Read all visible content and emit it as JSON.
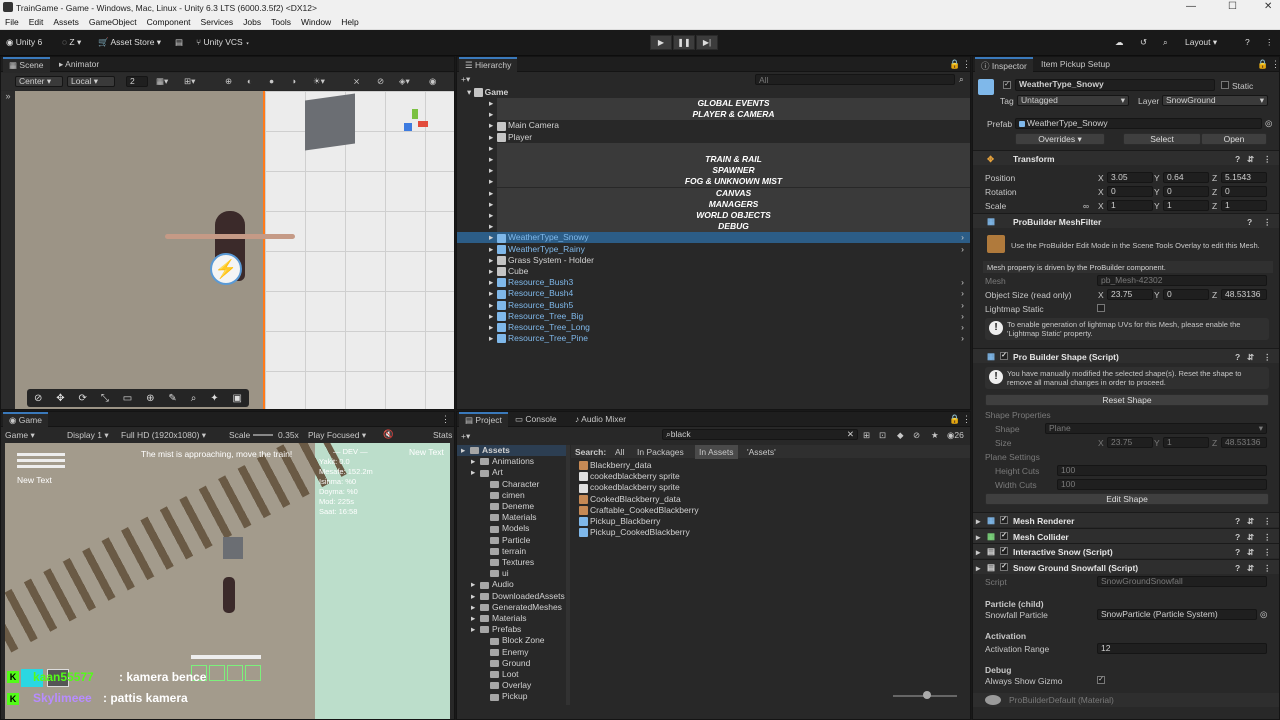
{
  "window": {
    "title": "TrainGame - Game - Windows, Mac, Linux - Unity 6.3 LTS (6000.3.5f2) <DX12>"
  },
  "menu": [
    "File",
    "Edit",
    "Assets",
    "GameObject",
    "Component",
    "Services",
    "Jobs",
    "Tools",
    "Window",
    "Help"
  ],
  "toolbar": {
    "account": "Unity 6",
    "user": "Z",
    "asset_store": "Asset Store",
    "vcs": "Unity VCS",
    "layout": "Layout"
  },
  "scene_panel": {
    "tabs": [
      "Scene",
      "Animator"
    ],
    "pivot": "Center",
    "space": "Local",
    "grid": "2"
  },
  "hierarchy": {
    "tab": "Hierarchy",
    "search_placeholder": "All",
    "root": "Game",
    "items": [
      {
        "label": "GLOBAL EVENTS",
        "kind": "sep"
      },
      {
        "label": "PLAYER & CAMERA",
        "kind": "sep"
      },
      {
        "label": "Main Camera",
        "kind": "obj"
      },
      {
        "label": "Player",
        "kind": "obj"
      },
      {
        "label": "",
        "kind": "sep"
      },
      {
        "label": "TRAIN & RAIL",
        "kind": "sep"
      },
      {
        "label": "SPAWNER",
        "kind": "sep"
      },
      {
        "label": "FOG & UNKNOWN MIST",
        "kind": "sep"
      },
      {
        "label": "CANVAS",
        "kind": "sep"
      },
      {
        "label": "MANAGERS",
        "kind": "sep"
      },
      {
        "label": "WORLD OBJECTS",
        "kind": "sep"
      },
      {
        "label": "DEBUG",
        "kind": "sep"
      },
      {
        "label": "WeatherType_Snowy",
        "kind": "prefab",
        "selected": true
      },
      {
        "label": "WeatherType_Rainy",
        "kind": "prefab"
      },
      {
        "label": "Grass System - Holder",
        "kind": "obj"
      },
      {
        "label": "Cube",
        "kind": "obj"
      },
      {
        "label": "Resource_Bush3",
        "kind": "prefab"
      },
      {
        "label": "Resource_Bush4",
        "kind": "prefab"
      },
      {
        "label": "Resource_Bush5",
        "kind": "prefab"
      },
      {
        "label": "Resource_Tree_Big",
        "kind": "prefab"
      },
      {
        "label": "Resource_Tree_Long",
        "kind": "prefab"
      },
      {
        "label": "Resource_Tree_Pine",
        "kind": "prefab"
      }
    ]
  },
  "game_panel": {
    "tab": "Game",
    "mode": "Game",
    "display": "Display 1",
    "resolution": "Full HD (1920x1080)",
    "scale_label": "Scale",
    "scale": "0.35x",
    "play_mode": "Play Focused",
    "stats": "Stats",
    "hud_text": "New Text",
    "hud_text2": "New Text",
    "banner": "The mist is approaching, move the train!",
    "debug_lines": [
      "— DEV —",
      "Yakit: 0.0",
      "Mesafe: 152.2m",
      "Isinma: %0",
      "Doyma: %0",
      "Mod: 225s",
      "Saat: 16:58"
    ],
    "chat": [
      {
        "user": "kaan55577",
        "msg": ": kamera bence"
      },
      {
        "user": "Skylimeee",
        "msg": ": pattis kamera"
      }
    ]
  },
  "project_panel": {
    "tabs": [
      "Project",
      "Console",
      "Audio Mixer"
    ],
    "search": "black",
    "search_label": "Search:",
    "filters": [
      "All",
      "In Packages",
      "In Assets",
      "'Assets'"
    ],
    "count": "26",
    "tree": [
      {
        "label": "Assets",
        "d": 0
      },
      {
        "label": "Animations",
        "d": 1
      },
      {
        "label": "Art",
        "d": 1
      },
      {
        "label": "Character",
        "d": 2
      },
      {
        "label": "cimen",
        "d": 2
      },
      {
        "label": "Deneme",
        "d": 2
      },
      {
        "label": "Materials",
        "d": 2
      },
      {
        "label": "Models",
        "d": 2
      },
      {
        "label": "Particle",
        "d": 2
      },
      {
        "label": "terrain",
        "d": 2
      },
      {
        "label": "Textures",
        "d": 2
      },
      {
        "label": "ui",
        "d": 2
      },
      {
        "label": "Audio",
        "d": 1
      },
      {
        "label": "DownloadedAssets",
        "d": 1
      },
      {
        "label": "GeneratedMeshes",
        "d": 1
      },
      {
        "label": "Materials",
        "d": 1
      },
      {
        "label": "Prefabs",
        "d": 1
      },
      {
        "label": "Block Zone",
        "d": 2
      },
      {
        "label": "Enemy",
        "d": 2
      },
      {
        "label": "Ground",
        "d": 2
      },
      {
        "label": "Loot",
        "d": 2
      },
      {
        "label": "Overlay",
        "d": 2
      },
      {
        "label": "Pickup",
        "d": 2
      }
    ],
    "results": [
      "Blackberry_data",
      "cookedblackberry sprite",
      "cookedblackberry sprite",
      "CookedBlackberry_data",
      "Craftable_CookedBlackberry",
      "Pickup_Blackberry",
      "Pickup_CookedBlackberry"
    ]
  },
  "inspector": {
    "tabs": [
      "Inspector",
      "Item Pickup Setup"
    ],
    "name": "WeatherType_Snowy",
    "static": "Static",
    "tag_label": "Tag",
    "tag": "Untagged",
    "layer_label": "Layer",
    "layer": "SnowGround",
    "prefab_label": "Prefab",
    "prefab": "WeatherType_Snowy",
    "overrides": "Overrides",
    "select": "Select",
    "open": "Open",
    "transform": {
      "title": "Transform",
      "position_label": "Position",
      "rotation_label": "Rotation",
      "scale_label": "Scale",
      "position": [
        "3.05",
        "0.64",
        "5.1543"
      ],
      "rotation": [
        "0",
        "0",
        "0"
      ],
      "scale": [
        "1",
        "1",
        "1"
      ]
    },
    "meshfilter": {
      "title": "ProBuilder MeshFilter",
      "info": "Use the ProBuilder Edit Mode in the Scene Tools Overlay to edit this Mesh.",
      "driven": "Mesh property is driven by the ProBuilder component.",
      "mesh_label": "Mesh",
      "mesh": "pb_Mesh-42302",
      "size_label": "Object Size (read only)",
      "size": [
        "23.75",
        "0",
        "48.53136"
      ],
      "lightmap_label": "Lightmap Static",
      "lightmap_info": "To enable generation of lightmap UVs for this Mesh, please enable the 'Lightmap Static' property."
    },
    "shape": {
      "title": "Pro Builder Shape (Script)",
      "warning": "You have manually modified the selected shape(s). Reset the shape to remove all manual changes in order to proceed.",
      "reset": "Reset Shape",
      "props_label": "Shape Properties",
      "shape_label": "Shape",
      "shape": "Plane",
      "size_label": "Size",
      "size": [
        "23.75",
        "1",
        "48.53136"
      ],
      "plane_label": "Plane Settings",
      "hcuts_label": "Height Cuts",
      "hcuts": "100",
      "wcuts_label": "Width Cuts",
      "wcuts": "100",
      "edit": "Edit Shape"
    },
    "components": [
      "Mesh Renderer",
      "Mesh Collider",
      "Interactive Snow (Script)",
      "Snow Ground Snowfall (Script)"
    ],
    "snowfall": {
      "script_label": "Script",
      "script": "SnowGroundSnowfall",
      "particle_head": "Particle (child)",
      "particle_label": "Snowfall Particle",
      "particle": "SnowParticle (Particle System)",
      "activation_head": "Activation",
      "range_label": "Activation Range",
      "range": "12",
      "debug_head": "Debug",
      "gizmo_label": "Always Show Gizmo"
    },
    "footer": "ProBuilderDefault (Material)"
  }
}
